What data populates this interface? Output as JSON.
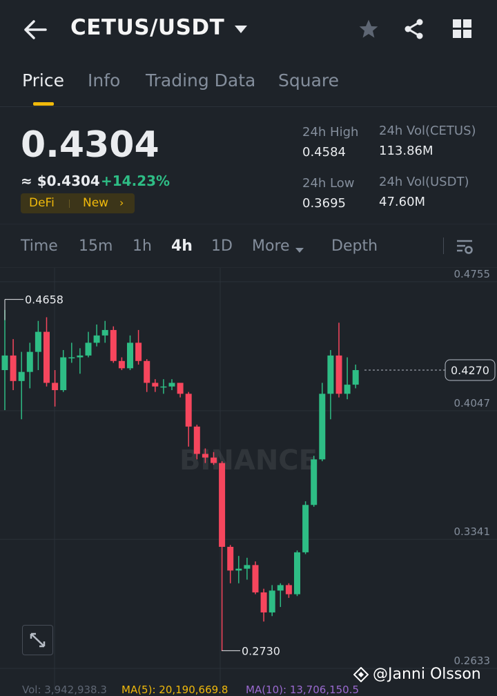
{
  "header": {
    "title": "CETUS/USDT",
    "icons": [
      "arrow-left-icon",
      "caret-down-icon",
      "star-icon",
      "share-icon",
      "grid-icon"
    ]
  },
  "tabs": [
    {
      "label": "Price",
      "active": true
    },
    {
      "label": "Info",
      "active": false
    },
    {
      "label": "Trading Data",
      "active": false
    },
    {
      "label": "Square",
      "active": false
    }
  ],
  "price": {
    "last": "0.4304",
    "approx": "≈ $0.4304",
    "change": "+14.23%",
    "tags": [
      "DeFi",
      "New"
    ],
    "tag_arrow": "›"
  },
  "stats": {
    "high_label": "24h High",
    "high": "0.4584",
    "low_label": "24h Low",
    "low": "0.3695",
    "vol_base_label": "24h Vol(CETUS)",
    "vol_base": "113.86M",
    "vol_quote_label": "24h Vol(USDT)",
    "vol_quote": "47.60M"
  },
  "intervals": [
    {
      "label": "Time",
      "active": false
    },
    {
      "label": "15m",
      "active": false
    },
    {
      "label": "1h",
      "active": false
    },
    {
      "label": "4h",
      "active": true
    },
    {
      "label": "1D",
      "active": false
    },
    {
      "label": "More",
      "active": false
    },
    {
      "label": "Depth",
      "active": false
    }
  ],
  "colors": {
    "up": "#2ebd85",
    "down": "#f6465d",
    "accent": "#f0b90b",
    "bg": "#1e2329"
  },
  "chart_data": {
    "type": "candlestick",
    "price_ticks": [
      "0.4755",
      "0.4047",
      "0.3341",
      "0.2633"
    ],
    "current_price": "0.4270",
    "high_marker": "0.4658",
    "low_marker": "0.2730",
    "watermark": "BINANCE",
    "candles": [
      [
        0.427,
        0.435,
        0.46,
        0.405
      ],
      [
        0.435,
        0.421,
        0.444,
        0.416
      ],
      [
        0.421,
        0.426,
        0.437,
        0.4
      ],
      [
        0.426,
        0.437,
        0.442,
        0.417
      ],
      [
        0.437,
        0.448,
        0.454,
        0.427
      ],
      [
        0.448,
        0.42,
        0.456,
        0.418
      ],
      [
        0.42,
        0.416,
        0.427,
        0.407
      ],
      [
        0.416,
        0.434,
        0.438,
        0.415
      ],
      [
        0.434,
        0.434,
        0.442,
        0.431
      ],
      [
        0.434,
        0.435,
        0.439,
        0.425
      ],
      [
        0.435,
        0.442,
        0.448,
        0.434
      ],
      [
        0.442,
        0.446,
        0.452,
        0.44
      ],
      [
        0.446,
        0.449,
        0.454,
        0.442
      ],
      [
        0.449,
        0.432,
        0.451,
        0.431
      ],
      [
        0.432,
        0.428,
        0.434,
        0.427
      ],
      [
        0.428,
        0.442,
        0.446,
        0.427
      ],
      [
        0.442,
        0.432,
        0.449,
        0.43
      ],
      [
        0.432,
        0.42,
        0.433,
        0.415
      ],
      [
        0.42,
        0.418,
        0.422,
        0.415
      ],
      [
        0.418,
        0.418,
        0.422,
        0.414
      ],
      [
        0.418,
        0.42,
        0.422,
        0.416
      ],
      [
        0.42,
        0.414,
        0.42,
        0.412
      ],
      [
        0.414,
        0.396,
        0.415,
        0.385
      ],
      [
        0.396,
        0.381,
        0.397,
        0.378
      ],
      [
        0.381,
        0.379,
        0.384,
        0.376
      ],
      [
        0.379,
        0.376,
        0.382,
        0.375
      ],
      [
        0.376,
        0.33,
        0.377,
        0.273
      ],
      [
        0.33,
        0.317,
        0.331,
        0.31
      ],
      [
        0.317,
        0.318,
        0.325,
        0.31
      ],
      [
        0.318,
        0.32,
        0.324,
        0.312
      ],
      [
        0.32,
        0.305,
        0.322,
        0.304
      ],
      [
        0.305,
        0.294,
        0.307,
        0.289
      ],
      [
        0.294,
        0.306,
        0.309,
        0.292
      ],
      [
        0.306,
        0.309,
        0.31,
        0.297
      ],
      [
        0.309,
        0.304,
        0.31,
        0.302
      ],
      [
        0.304,
        0.327,
        0.328,
        0.303
      ],
      [
        0.327,
        0.353,
        0.355,
        0.326
      ],
      [
        0.353,
        0.378,
        0.38,
        0.352
      ],
      [
        0.378,
        0.414,
        0.42,
        0.377
      ],
      [
        0.414,
        0.435,
        0.438,
        0.4
      ],
      [
        0.435,
        0.414,
        0.453,
        0.412
      ],
      [
        0.414,
        0.419,
        0.434,
        0.411
      ],
      [
        0.419,
        0.427,
        0.43,
        0.417
      ]
    ]
  },
  "expand_icon": "expand-icon",
  "watermark_handle": "@Janni Olsson",
  "bottom_stats": {
    "vol": "Vol: 3,942,938.3",
    "ma5": "MA(5): 20,190,669.8",
    "ma10": "MA(10): 13,706,150.5"
  }
}
